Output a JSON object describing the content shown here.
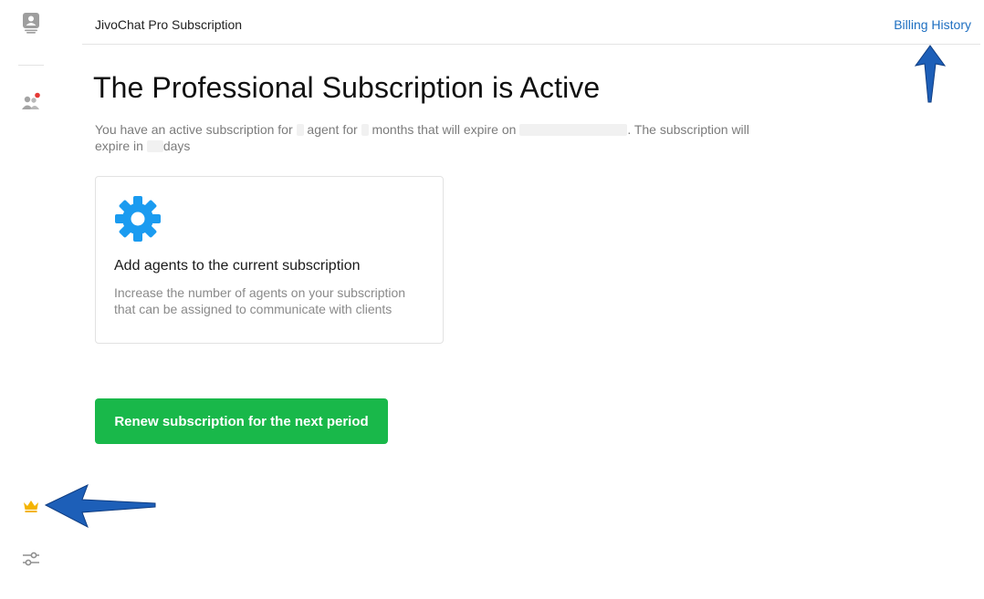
{
  "header": {
    "title": "JivoChat Pro Subscription",
    "billing_link": "Billing History"
  },
  "sidebar": {
    "icons": [
      "contact-card-icon",
      "team-icon",
      "crown-icon",
      "settings-sliders-icon"
    ],
    "notification_color": "#e53935",
    "crown_color": "#f4b400"
  },
  "main": {
    "title": "The Professional Subscription is Active",
    "desc_part1": "You have an active subscription for",
    "desc_part2": "agent for",
    "desc_part3": "months that will expire on",
    "desc_part4": ". The subscription will expire in",
    "desc_part5": "days",
    "card": {
      "icon": "gear-icon",
      "title": "Add agents to the current subscription",
      "text": "Increase the number of agents on your subscription that can be assigned to communicate with clients"
    },
    "renew_button": "Renew subscription for the next period"
  },
  "colors": {
    "accent_green": "#19b84a",
    "link_blue": "#1e6fc1",
    "gear_blue": "#1a9bf0",
    "arrow_blue": "#1d5fb8"
  }
}
